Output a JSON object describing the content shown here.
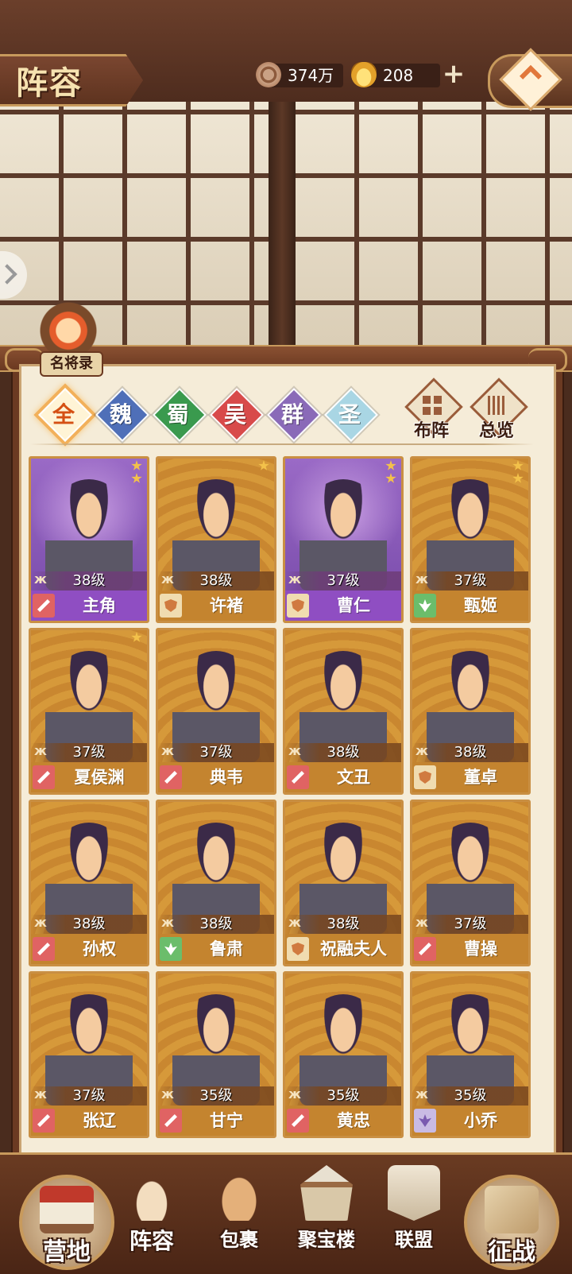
{
  "header": {
    "title": "阵容",
    "copper": "374万",
    "gold": "208",
    "add_label": "+"
  },
  "roster": {
    "label": "名将录"
  },
  "factions": [
    {
      "label": "全",
      "color": "#f3a33a",
      "active": true
    },
    {
      "label": "魏",
      "color": "#4f6fb8",
      "active": false
    },
    {
      "label": "蜀",
      "color": "#3a9a4e",
      "active": false
    },
    {
      "label": "吴",
      "color": "#d84a4a",
      "active": false
    },
    {
      "label": "群",
      "color": "#8a6ab8",
      "active": false
    },
    {
      "label": "圣",
      "color": "#a9d6e4",
      "active": false
    }
  ],
  "actions": {
    "formation": "布阵",
    "overview": "总览"
  },
  "heroes": [
    {
      "name": "主角",
      "level": "38级",
      "stars": 2,
      "quality": "purple",
      "role": "red"
    },
    {
      "name": "许褚",
      "level": "38级",
      "stars": 1,
      "quality": "orange",
      "role": "tan"
    },
    {
      "name": "曹仁",
      "level": "37级",
      "stars": 2,
      "quality": "purple",
      "role": "tan"
    },
    {
      "name": "甄姬",
      "level": "37级",
      "stars": 2,
      "quality": "orange",
      "role": "green"
    },
    {
      "name": "夏侯渊",
      "level": "37级",
      "stars": 1,
      "quality": "orange",
      "role": "red"
    },
    {
      "name": "典韦",
      "level": "37级",
      "stars": 0,
      "quality": "orange",
      "role": "red"
    },
    {
      "name": "文丑",
      "level": "38级",
      "stars": 0,
      "quality": "orange",
      "role": "red"
    },
    {
      "name": "董卓",
      "level": "38级",
      "stars": 0,
      "quality": "orange",
      "role": "tan"
    },
    {
      "name": "孙权",
      "level": "38级",
      "stars": 0,
      "quality": "orange",
      "role": "red"
    },
    {
      "name": "鲁肃",
      "level": "38级",
      "stars": 0,
      "quality": "orange",
      "role": "green"
    },
    {
      "name": "祝融夫人",
      "level": "38级",
      "stars": 0,
      "quality": "orange",
      "role": "tan"
    },
    {
      "name": "曹操",
      "level": "37级",
      "stars": 0,
      "quality": "orange",
      "role": "red"
    },
    {
      "name": "张辽",
      "level": "37级",
      "stars": 0,
      "quality": "orange",
      "role": "red"
    },
    {
      "name": "甘宁",
      "level": "35级",
      "stars": 0,
      "quality": "orange",
      "role": "red"
    },
    {
      "name": "黄忠",
      "level": "35级",
      "stars": 0,
      "quality": "orange",
      "role": "red"
    },
    {
      "name": "小乔",
      "level": "35级",
      "stars": 0,
      "quality": "orange",
      "role": "lav"
    }
  ],
  "level_symbol": "ж",
  "nav": {
    "camp": "营地",
    "lineup": "阵容",
    "bag": "包裹",
    "treasure": "聚宝楼",
    "alliance": "联盟",
    "battle": "征战"
  }
}
